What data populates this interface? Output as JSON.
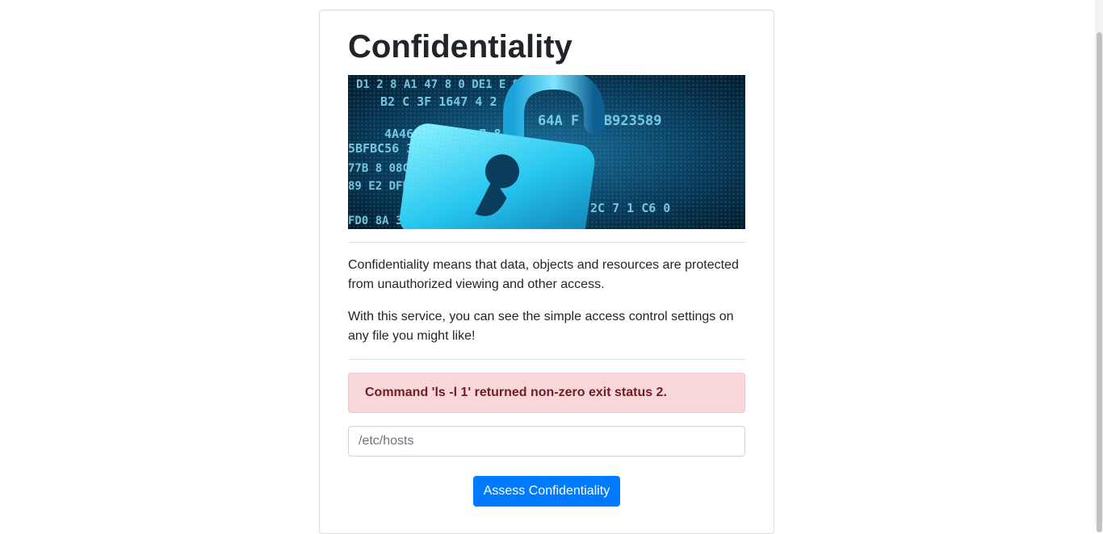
{
  "page": {
    "title": "Confidentiality"
  },
  "hero": {
    "image_label": "padlock over binary data",
    "hex_rows": [
      "D1  2  8  A1 47  8 0  DE1 E  92B5",
      "B2  C  3F  1647 4  2",
      "64A  F  01B923589",
      "4A468  9053F0  7  8",
      "5BFBC56  3  A376C7  1  0",
      "77B  8  08C1  F  2  9",
      "89  E2  DFEA  1  3",
      "FD0  8A  3A  B4  F",
      "2C  7  1  C6  0"
    ]
  },
  "content": {
    "paragraph_1": "Confidentiality means that data, objects and resources are protected from unauthorized viewing and other access.",
    "paragraph_2": "With this service, you can see the simple access control settings on any file you might like!"
  },
  "alert": {
    "message": "Command 'ls -l 1' returned non-zero exit status 2."
  },
  "form": {
    "file_input_placeholder": "/etc/hosts",
    "submit_label": "Assess Confidentiality"
  },
  "colors": {
    "alert_bg": "#f8d7da",
    "alert_text": "#721c24",
    "button_bg": "#007bff"
  }
}
